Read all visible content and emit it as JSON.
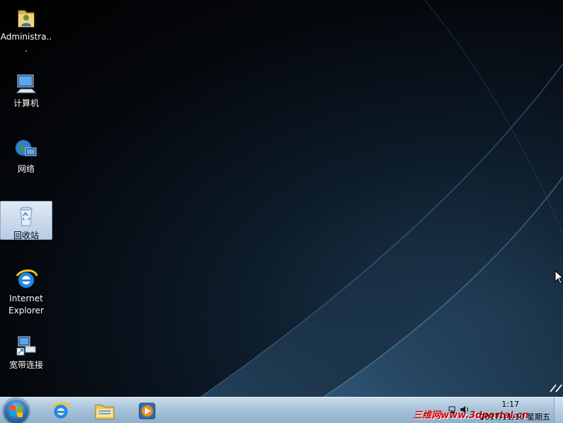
{
  "desktop": {
    "icons": [
      {
        "label": "Administra...",
        "icon": "user-folder-icon"
      },
      {
        "label": "计算机",
        "icon": "computer-icon"
      },
      {
        "label": "网络",
        "icon": "network-icon"
      },
      {
        "label": "回收站",
        "icon": "recycle-bin-icon",
        "selected": true
      },
      {
        "label": "Internet Explorer",
        "icon": "ie-icon"
      },
      {
        "label": "宽带连接",
        "icon": "broadband-connection-icon"
      }
    ]
  },
  "taskbar": {
    "pinned": [
      "internet-explorer-icon",
      "file-explorer-icon",
      "media-player-icon"
    ],
    "clock": {
      "time": "1:17",
      "date": "2017/11/10 星期五"
    },
    "watermark": "三维网www.3dportal.cn"
  },
  "colors": {
    "taskbar": "#a9c3d9",
    "watermark": "#d00000",
    "selection": "#b8cce4"
  }
}
